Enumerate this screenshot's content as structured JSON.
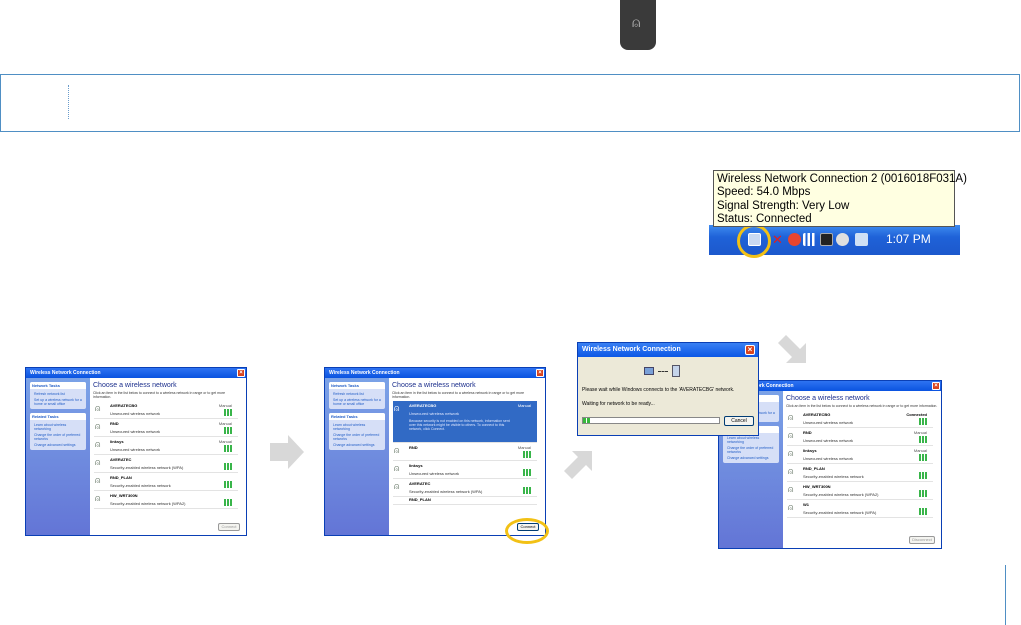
{
  "tooltip": {
    "line1": "Wireless Network Connection 2 (0016018F031A)",
    "line2": "Speed: 54.0 Mbps",
    "line3": "Signal Strength: Very Low",
    "line4": "Status: Connected"
  },
  "taskbar": {
    "clock": "1:07 PM"
  },
  "window1": {
    "title": "Wireless Network Connection",
    "heading": "Choose a wireless network",
    "instructions": "Click an item in the list below to connect to a wireless network in range or to get more information.",
    "network_tasks": "Network Tasks",
    "refresh": "Refresh network list",
    "setup": "Set up a wireless network for a home or small office",
    "related_tasks": "Related Tasks",
    "learn": "Learn about wireless networking",
    "change_order": "Change the order of preferred networks",
    "change_adv": "Change advanced settings",
    "connect": "Connect",
    "networks": [
      {
        "name": "AVERATECBG",
        "status": "Manual",
        "security": "Unsecured wireless network"
      },
      {
        "name": "RND",
        "status": "Manual",
        "security": "Unsecured wireless network"
      },
      {
        "name": "linksys",
        "status": "Manual",
        "security": "Unsecured wireless network"
      },
      {
        "name": "AVERATEC",
        "status": "",
        "security": "Security-enabled wireless network (WPA)"
      },
      {
        "name": "RND_PLAN",
        "status": "",
        "security": "Security-enabled wireless network"
      },
      {
        "name": "HW_WRT300N",
        "status": "",
        "security": "Security-enabled wireless network (WPA2)"
      }
    ]
  },
  "window2": {
    "title": "Wireless Network Connection",
    "heading": "Choose a wireless network",
    "selected_note": "Because security is not enabled on this network, information sent over this network might be visible to others. To connect to this network, click Connect.",
    "connect": "Connect",
    "networks": [
      {
        "name": "AVERATECBG",
        "status": "Manual",
        "security": "Unsecured wireless network"
      },
      {
        "name": "RND",
        "status": "Manual",
        "security": ""
      },
      {
        "name": "linksys",
        "status": "",
        "security": "Unsecured wireless network"
      },
      {
        "name": "AVERATEC",
        "status": "",
        "security": "Security-enabled wireless network (WPA)"
      },
      {
        "name": "RND_PLAN",
        "status": "",
        "security": ""
      }
    ]
  },
  "dialog": {
    "title": "Wireless Network Connection",
    "message": "Please wait while Windows connects to the 'AVERATECBG' network.",
    "waiting": "Waiting for network to be ready...",
    "cancel": "Cancel",
    "progress": 0.05
  },
  "window3": {
    "title": "Wireless Network Connection",
    "heading": "Choose a wireless network",
    "connect": "Disconnect",
    "networks": [
      {
        "name": "AVERATECBG",
        "status": "Connected",
        "security": "Unsecured wireless network"
      },
      {
        "name": "RND",
        "status": "Manual",
        "security": "Unsecured wireless network"
      },
      {
        "name": "linksys",
        "status": "Manual",
        "security": "Unsecured wireless network"
      },
      {
        "name": "RND_PLAN",
        "status": "",
        "security": "Security-enabled wireless network"
      },
      {
        "name": "HW_WRT300N",
        "status": "",
        "security": "Security-enabled wireless network (WPA2)"
      },
      {
        "name": "W1",
        "status": "",
        "security": "Security-enabled wireless network (WPA)"
      }
    ]
  }
}
